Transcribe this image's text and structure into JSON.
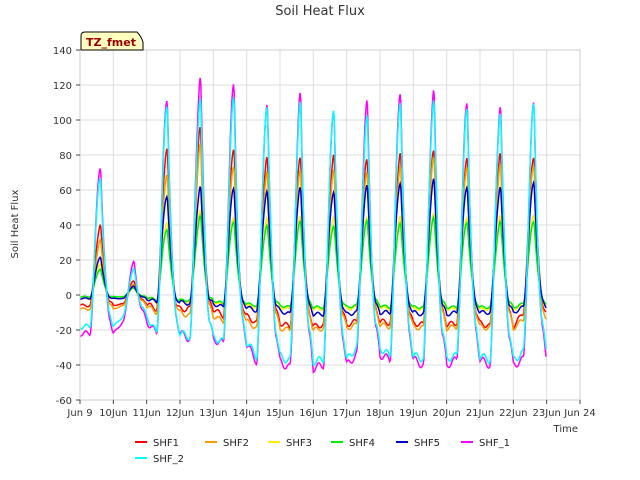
{
  "chart_data": {
    "type": "line",
    "title": "Soil Heat Flux",
    "xlabel": "Time",
    "ylabel": "Soil Heat Flux",
    "annotation": "TZ_fmet",
    "xlim": [
      9,
      24
    ],
    "ylim": [
      -60,
      140
    ],
    "x_ticks": [
      {
        "x": 9,
        "label": "Jun 9"
      },
      {
        "x": 10,
        "label": "10Jun"
      },
      {
        "x": 11,
        "label": "11Jun"
      },
      {
        "x": 12,
        "label": "12Jun"
      },
      {
        "x": 13,
        "label": "13Jun"
      },
      {
        "x": 14,
        "label": "14Jun"
      },
      {
        "x": 15,
        "label": "15Jun"
      },
      {
        "x": 16,
        "label": "16Jun"
      },
      {
        "x": 17,
        "label": "17Jun"
      },
      {
        "x": 18,
        "label": "18Jun"
      },
      {
        "x": 19,
        "label": "19Jun"
      },
      {
        "x": 20,
        "label": "20Jun"
      },
      {
        "x": 21,
        "label": "21Jun"
      },
      {
        "x": 22,
        "label": "22Jun"
      },
      {
        "x": 23,
        "label": "23Jun"
      },
      {
        "x": 24,
        "label": "Jun 24"
      }
    ],
    "y_ticks": [
      -60,
      -40,
      -20,
      0,
      20,
      40,
      60,
      80,
      100,
      120,
      140
    ],
    "grid": true,
    "legend_position": "bottom",
    "days": [
      9.5,
      10.5,
      11.5,
      12.5,
      13.5,
      14.5,
      15.5,
      16.5,
      17.5,
      18.5,
      19.5,
      20.5,
      21.5,
      22.5
    ],
    "series": [
      {
        "name": "SHF1",
        "color": "#ff0000",
        "peaks": [
          40,
          8,
          85,
          95,
          85,
          78,
          80,
          80,
          78,
          82,
          82,
          80,
          80,
          80
        ],
        "troughs": [
          -6,
          -5,
          -8,
          -8,
          -12,
          -16,
          -18,
          -17,
          -15,
          -16,
          -17,
          -16,
          -18,
          -10
        ]
      },
      {
        "name": "SHF2",
        "color": "#ff9900",
        "peaks": [
          32,
          6,
          70,
          85,
          75,
          70,
          72,
          72,
          70,
          75,
          78,
          75,
          74,
          75
        ],
        "troughs": [
          -8,
          -6,
          -10,
          -12,
          -15,
          -19,
          -20,
          -19,
          -17,
          -18,
          -19,
          -18,
          -19,
          -14
        ]
      },
      {
        "name": "SHF3",
        "color": "#ffee00",
        "peaks": [
          18,
          4,
          42,
          48,
          45,
          44,
          45,
          45,
          44,
          46,
          46,
          45,
          45,
          46
        ],
        "troughs": [
          -2,
          -2,
          -4,
          -4,
          -6,
          -7,
          -8,
          -8,
          -7,
          -8,
          -8,
          -8,
          -8,
          -6
        ]
      },
      {
        "name": "SHF4",
        "color": "#00ee00",
        "peaks": [
          15,
          4,
          38,
          45,
          42,
          40,
          42,
          40,
          42,
          42,
          44,
          42,
          42,
          42
        ],
        "troughs": [
          -1,
          -1,
          -3,
          -3,
          -5,
          -6,
          -7,
          -7,
          -6,
          -7,
          -7,
          -7,
          -7,
          -5
        ]
      },
      {
        "name": "SHF5",
        "color": "#0000cc",
        "peaks": [
          22,
          5,
          57,
          62,
          61,
          60,
          61,
          60,
          62,
          65,
          66,
          62,
          62,
          64
        ],
        "troughs": [
          -2,
          -2,
          -4,
          -5,
          -7,
          -9,
          -11,
          -11,
          -10,
          -10,
          -11,
          -10,
          -10,
          -7
        ]
      },
      {
        "name": "SHF_1",
        "color": "#ff00ff",
        "peaks": [
          74,
          19,
          112,
          125,
          120,
          111,
          114,
          108,
          110,
          117,
          117,
          110,
          109,
          109
        ],
        "troughs": [
          -22,
          -15,
          -22,
          -25,
          -28,
          -38,
          -42,
          -40,
          -34,
          -37,
          -40,
          -37,
          -40,
          -37
        ]
      },
      {
        "name": "SHF_2",
        "color": "#00ffff",
        "peaks": [
          68,
          15,
          108,
          114,
          112,
          110,
          109,
          108,
          102,
          111,
          112,
          106,
          106,
          108
        ],
        "troughs": [
          -18,
          -12,
          -22,
          -24,
          -27,
          -35,
          -38,
          -37,
          -30,
          -35,
          -36,
          -35,
          -37,
          -33
        ]
      }
    ]
  }
}
